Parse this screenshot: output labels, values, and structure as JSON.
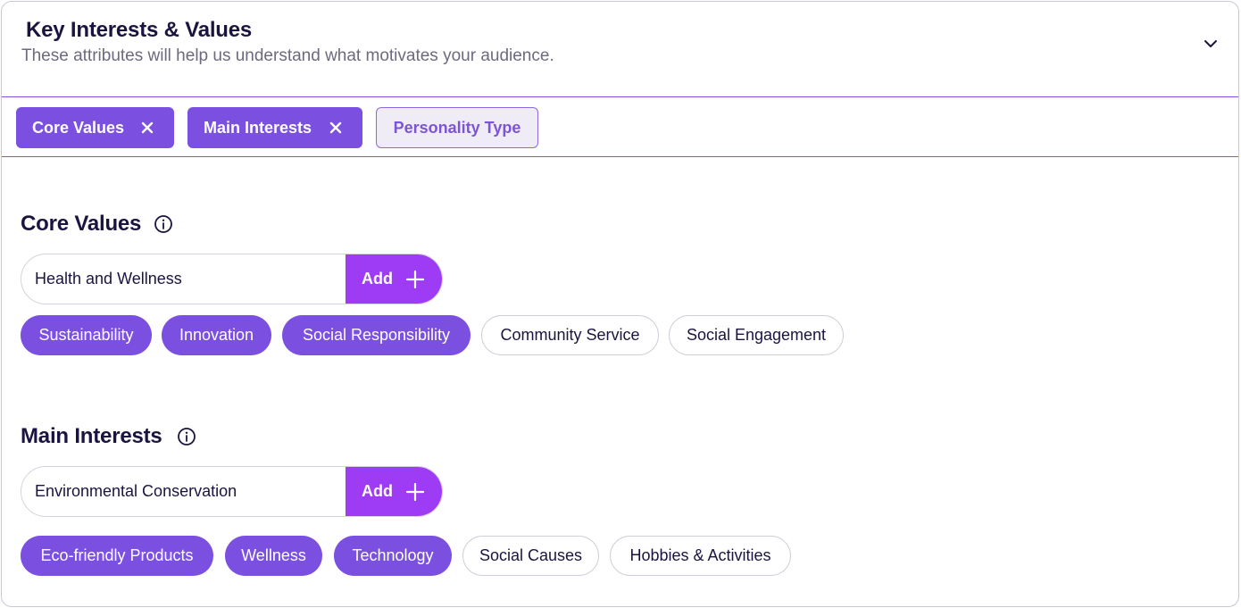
{
  "header": {
    "title": "Key Interests & Values",
    "subtitle": "These attributes will help us understand what motivates your audience."
  },
  "tabs": [
    {
      "label": "Core Values",
      "active": true
    },
    {
      "label": "Main Interests",
      "active": true
    },
    {
      "label": "Personality Type",
      "active": false
    }
  ],
  "core_values": {
    "title": "Core Values",
    "input_value": "Health and Wellness",
    "add_label": "Add",
    "chips": [
      {
        "label": "Sustainability",
        "selected": true
      },
      {
        "label": "Innovation",
        "selected": true
      },
      {
        "label": "Social Responsibility",
        "selected": true
      },
      {
        "label": "Community Service",
        "selected": false
      },
      {
        "label": "Social Engagement",
        "selected": false
      }
    ]
  },
  "main_interests": {
    "title": "Main Interests",
    "input_value": "Environmental Conservation",
    "add_label": "Add",
    "chips": [
      {
        "label": "Eco-friendly Products",
        "selected": true
      },
      {
        "label": "Wellness",
        "selected": true
      },
      {
        "label": "Technology",
        "selected": true
      },
      {
        "label": "Social Causes",
        "selected": false
      },
      {
        "label": "Hobbies & Activities",
        "selected": false
      }
    ]
  },
  "colors": {
    "accent": "#7b4fe0",
    "add_button": "#9e3bf5",
    "divider": "#8a4fe3",
    "text_dark": "#1b1440",
    "text_muted": "#6c6a7e"
  },
  "icons": {
    "collapse": "chevron-down-icon",
    "remove": "close-icon",
    "info": "info-icon",
    "add": "plus-icon"
  }
}
